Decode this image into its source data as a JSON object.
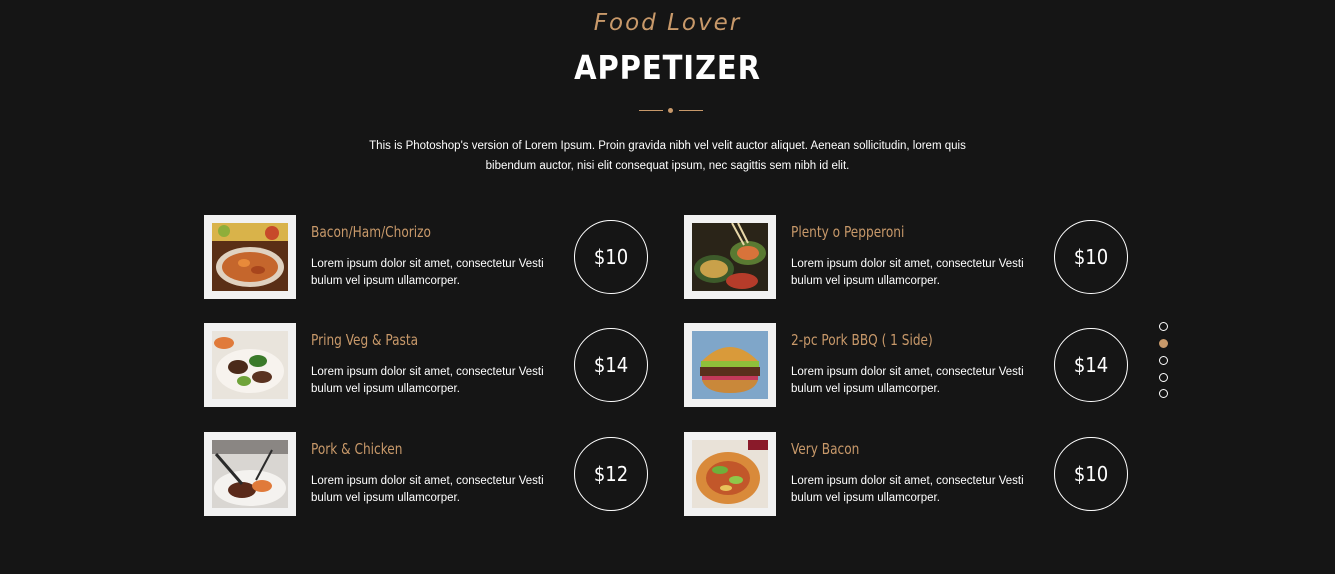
{
  "header": {
    "subtitle": "Food Lover",
    "title": "APPETIZER",
    "intro": "This is Photoshop's version of Lorem Ipsum. Proin gravida nibh vel velit auctor aliquet. Aenean sollicitudin, lorem quis bibendum auctor, nisi elit consequat ipsum, nec sagittis sem nibh id elit."
  },
  "colors": {
    "background": "#151515",
    "accent": "#c8996a",
    "text": "#ffffff"
  },
  "menu": {
    "items": [
      {
        "name": "Bacon/Ham/Chorizo",
        "description": "Lorem ipsum dolor sit amet, consectetur Vesti bulum vel ipsum ullamcorper.",
        "price": "$10",
        "image": "curry-bowl-photo"
      },
      {
        "name": "Plenty o Pepperoni",
        "description": "Lorem ipsum dolor sit amet, consectetur Vesti bulum vel ipsum ullamcorper.",
        "price": "$10",
        "image": "asian-dishes-photo"
      },
      {
        "name": "Pring Veg & Pasta",
        "description": "Lorem ipsum dolor sit amet, consectetur Vesti bulum vel ipsum ullamcorper.",
        "price": "$14",
        "image": "veg-pasta-photo"
      },
      {
        "name": "2-pc Pork BBQ ( 1 Side)",
        "description": "Lorem ipsum dolor sit amet, consectetur Vesti bulum vel ipsum ullamcorper.",
        "price": "$14",
        "image": "burger-photo"
      },
      {
        "name": "Pork & Chicken",
        "description": "Lorem ipsum dolor sit amet, consectetur Vesti bulum vel ipsum ullamcorper.",
        "price": "$12",
        "image": "steak-plate-photo"
      },
      {
        "name": "Very Bacon",
        "description": "Lorem ipsum dolor sit amet, consectetur Vesti bulum vel ipsum ullamcorper.",
        "price": "$10",
        "image": "salad-bowl-photo"
      }
    ]
  },
  "pager": {
    "count": 5,
    "active_index": 1
  }
}
